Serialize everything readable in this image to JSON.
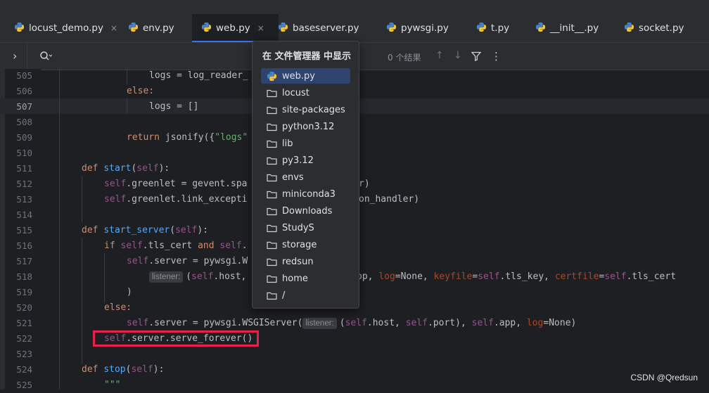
{
  "tabs": [
    {
      "label": "locust_demo.py",
      "close": "×"
    },
    {
      "label": "env.py"
    },
    {
      "label": "web.py",
      "close": "×"
    },
    {
      "label": "baseserver.py"
    },
    {
      "label": "pywsgi.py"
    },
    {
      "label": "t.py"
    },
    {
      "label": "__init__.py"
    },
    {
      "label": "socket.py"
    }
  ],
  "find_bar": {
    "expand": "›",
    "results": "0 个结果",
    "prev": "↑",
    "next": "↓",
    "more": "⋮"
  },
  "popup": {
    "title": "在 文件管理器 中显示",
    "items": [
      "web.py",
      "locust",
      "site-packages",
      "python3.12",
      "lib",
      "py3.12",
      "envs",
      "miniconda3",
      "Downloads",
      "StudyS",
      "storage",
      "redsun",
      "home",
      "/"
    ]
  },
  "editor": {
    "line_numbers": [
      "505",
      "506",
      "507",
      "508",
      "509",
      "510",
      "511",
      "512",
      "513",
      "514",
      "515",
      "516",
      "517",
      "518",
      "519",
      "520",
      "521",
      "522",
      "523",
      "524",
      "525"
    ],
    "current_line": "507",
    "code": {
      "l505": "logs = log_reader_",
      "l506": "else:",
      "l507": "logs = []",
      "l509_ret": "return",
      "l509_fn": " jsonify({",
      "l509_str": "\"logs\"",
      "l511_def": "def ",
      "l511_name": "start",
      "l511_self": "self",
      "l512_self": "self",
      "l512_rest": ".greenlet = gevent.spa",
      "l512_tail": "r)",
      "l513_self": "self",
      "l513_rest": ".greenlet.link_excepti",
      "l513_tail": "on_handler)",
      "l515_def": "def ",
      "l515_name": "start_server",
      "l515_self": "self",
      "l516_if": "if ",
      "l516_self": "self",
      "l516_rest": ".tls_cert ",
      "l516_and": "and ",
      "l516_self2": "self",
      "l516_dot": ".",
      "l517_self": "self",
      "l517_rest": ".server = pywsgi.W",
      "l518_hint": "listener:",
      "l518_a": "(",
      "l518_self": "self",
      "l518_b": ".host, ",
      "l518_c": "pp, ",
      "l518_log": "log",
      "l518_d": "=None, ",
      "l518_kf": "keyfile",
      "l518_e": "=",
      "l518_self2": "self",
      "l518_f": ".tls_key, ",
      "l518_cf": "certfile",
      "l518_g": "=",
      "l518_self3": "self",
      "l518_h": ".tls_cert",
      "l519": ")",
      "l520": "else:",
      "l521_self": "self",
      "l521_rest": ".server = pywsgi.WSGIServer(",
      "l521_hint": "listener:",
      "l521_a": "(",
      "l521_self2": "self",
      "l521_b": ".host, ",
      "l521_self3": "self",
      "l521_c": ".port), ",
      "l521_self4": "self",
      "l521_d": ".app, ",
      "l521_log": "log",
      "l521_e": "=None)",
      "l522_self": "self",
      "l522_rest": ".server.serve_forever()",
      "l524_def": "def ",
      "l524_name": "stop",
      "l524_self": "self",
      "l525": "\"\"\""
    }
  },
  "watermark": "CSDN @Qredsun",
  "colors": {
    "accent": "#3574f0",
    "highlight_box": "#e8214b",
    "keyword": "#cf8e6d",
    "self": "#94558d",
    "function": "#56a8f5",
    "string": "#6aab73"
  }
}
